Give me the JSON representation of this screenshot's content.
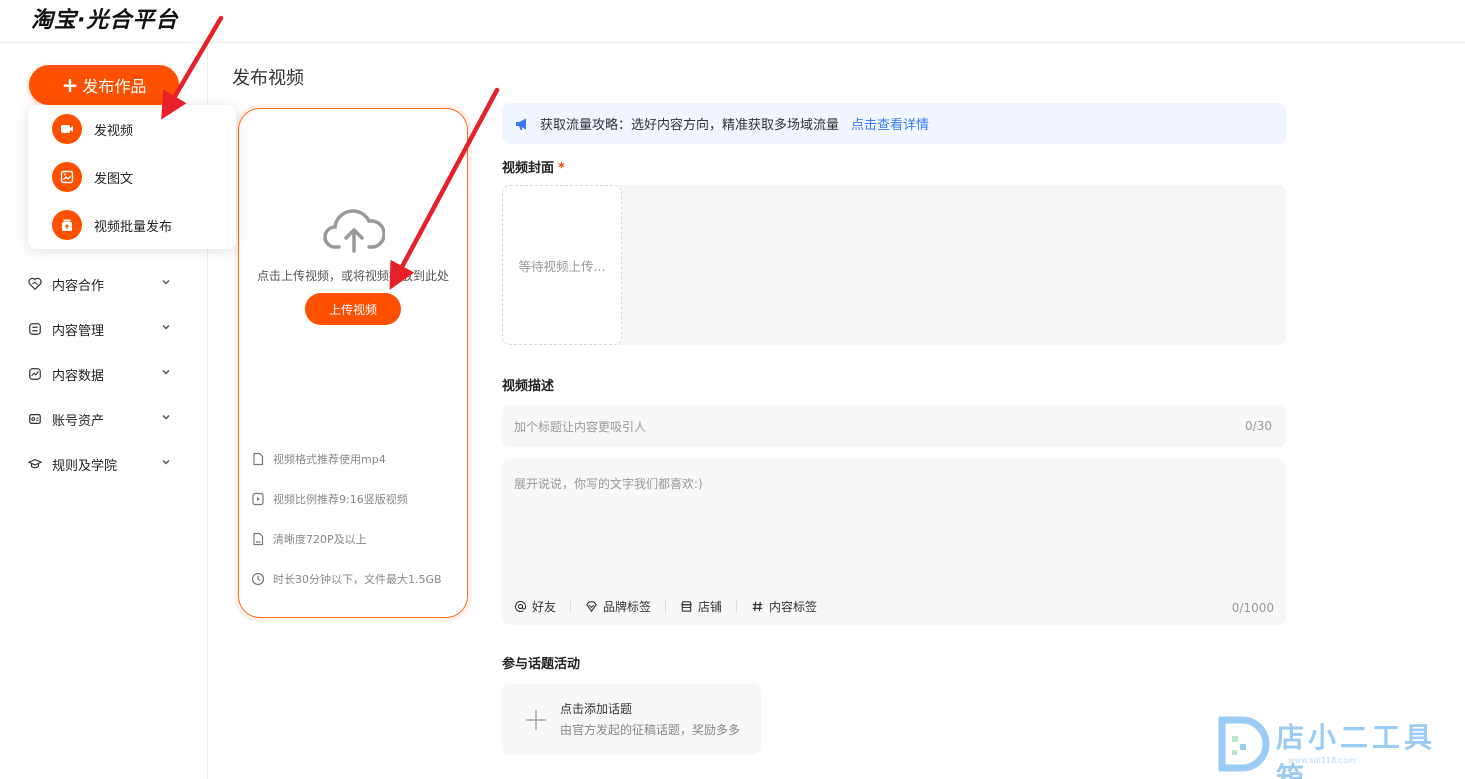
{
  "header": {
    "logo": "淘宝·光合平台"
  },
  "sidebar": {
    "publish_button": "发布作品",
    "dropdown": [
      {
        "label": "发视频",
        "icon": "video-camera-icon"
      },
      {
        "label": "发图文",
        "icon": "image-text-icon"
      },
      {
        "label": "视频批量发布",
        "icon": "batch-upload-icon"
      }
    ],
    "nav": [
      {
        "label": "内容合作",
        "icon": "handshake-icon"
      },
      {
        "label": "内容管理",
        "icon": "content-manage-icon"
      },
      {
        "label": "内容数据",
        "icon": "chart-line-icon"
      },
      {
        "label": "账号资产",
        "icon": "account-asset-icon"
      },
      {
        "label": "规则及学院",
        "icon": "graduation-cap-icon"
      }
    ]
  },
  "main": {
    "page_title": "发布视频",
    "upload": {
      "hint": "点击上传视频，或将视频拖放到此处",
      "button": "上传视频",
      "specs": [
        {
          "text": "视频格式推荐使用mp4",
          "icon": "file-icon"
        },
        {
          "text": "视频比例推荐9:16竖版视频",
          "icon": "play-circle-icon"
        },
        {
          "text": "清晰度720P及以上",
          "icon": "hd-file-icon"
        },
        {
          "text": "时长30分钟以下，文件最大1.5GB",
          "icon": "clock-icon"
        }
      ]
    },
    "banner": {
      "text": "获取流量攻略：选好内容方向，精准获取多场域流量",
      "link": "点击查看详情"
    },
    "cover": {
      "label": "视频封面",
      "required_mark": "*",
      "placeholder": "等待视频上传..."
    },
    "description": {
      "label": "视频描述",
      "title_placeholder": "加个标题让内容更吸引人",
      "title_count": "0/30",
      "body_placeholder": "展开说说，你写的文字我们都喜欢:)",
      "body_count": "0/1000",
      "tools": [
        {
          "label": "好友",
          "icon": "at-icon"
        },
        {
          "label": "品牌标签",
          "icon": "brand-tag-icon"
        },
        {
          "label": "店铺",
          "icon": "store-icon"
        },
        {
          "label": "内容标签",
          "icon": "hashtag-icon"
        }
      ]
    },
    "topic": {
      "label": "参与话题活动",
      "title": "点击添加话题",
      "subtitle": "由官方发起的征稿话题，奖励多多"
    }
  },
  "watermark": {
    "text": "店小二工具箱",
    "url": "www.sdl118.com"
  },
  "colors": {
    "accent": "#ff5000",
    "link": "#3a7bf4",
    "arrow": "#e8202a"
  }
}
